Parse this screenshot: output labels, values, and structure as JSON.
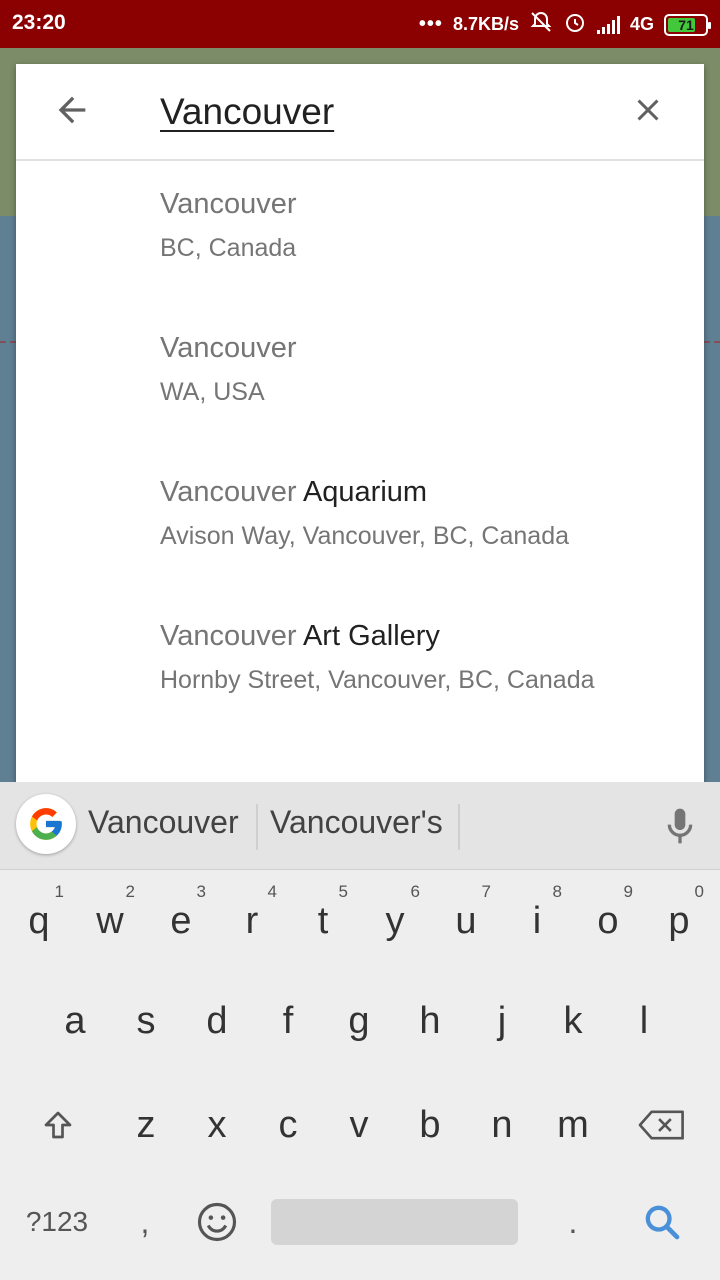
{
  "status_bar": {
    "time": "23:20",
    "dots": "•••",
    "net_speed": "8.7KB/s",
    "network": "4G",
    "battery": "71",
    "battery_level": 0.71,
    "battery_color": "#42c83a",
    "bar_color": "#8b0000"
  },
  "search": {
    "query": "Vancouver",
    "back_icon": "arrow-back-icon",
    "clear_icon": "close-icon"
  },
  "results": [
    {
      "prefix": "Vancouver",
      "bold": "",
      "sub": "BC, Canada"
    },
    {
      "prefix": "Vancouver",
      "bold": "",
      "sub": "WA, USA"
    },
    {
      "prefix": "Vancouver",
      "bold": " Aquarium",
      "sub": "Avison Way, Vancouver, BC, Canada"
    },
    {
      "prefix": "Vancouver",
      "bold": " Art Gallery",
      "sub": "Hornby Street, Vancouver, BC, Canada"
    }
  ],
  "keyboard": {
    "suggestions": [
      "Vancouver",
      "Vancouver's"
    ],
    "row1": [
      "q",
      "w",
      "e",
      "r",
      "t",
      "y",
      "u",
      "i",
      "o",
      "p"
    ],
    "row1_hints": [
      "1",
      "2",
      "3",
      "4",
      "5",
      "6",
      "7",
      "8",
      "9",
      "0"
    ],
    "row2": [
      "a",
      "s",
      "d",
      "f",
      "g",
      "h",
      "j",
      "k",
      "l"
    ],
    "row3": [
      "z",
      "x",
      "c",
      "v",
      "b",
      "n",
      "m"
    ],
    "symbols_label": "?123",
    "comma": ",",
    "period": ".",
    "accent_color": "#4a90d9"
  }
}
